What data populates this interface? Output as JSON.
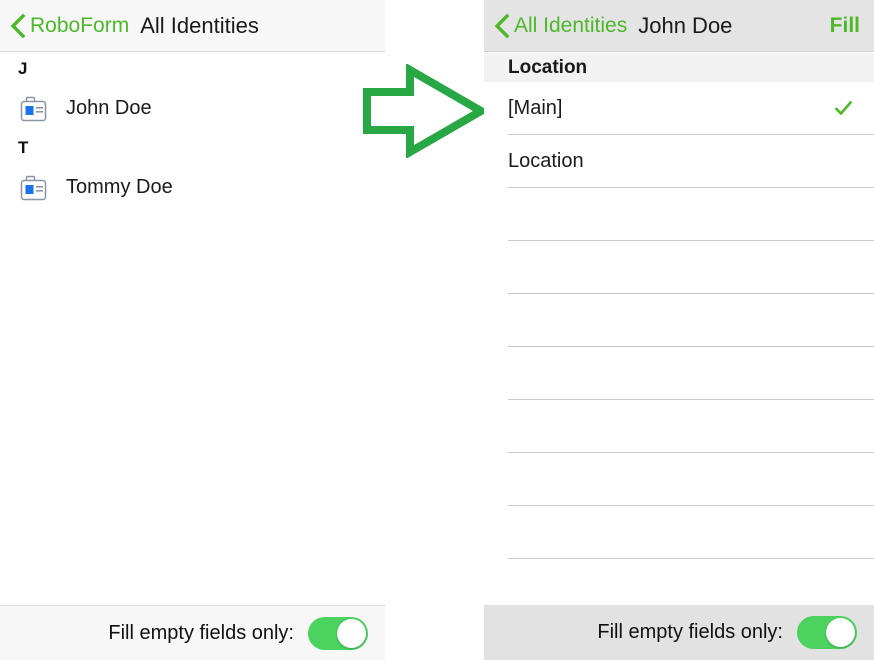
{
  "colors": {
    "accent_green": "#4cb82a",
    "toggle_green": "#4cd35f",
    "arrow_green": "#28a745",
    "icon_blue": "#1a73e8",
    "navbar_left_bg": "#f7f7f7",
    "navbar_right_bg": "#e4e4e4",
    "group_header_bg": "#f2f2f2",
    "bottombar_left_bg": "#f7f7f7",
    "bottombar_right_bg": "#e2e2e2",
    "text_primary": "#1a1a1a",
    "separator": "#c8c8c8"
  },
  "left_panel": {
    "navbar": {
      "back_icon": "chevron-left-icon",
      "back_label": "RoboForm",
      "title": "All Identities"
    },
    "sections": [
      {
        "letter": "J",
        "items": [
          {
            "icon": "id-card-icon",
            "label": "John Doe"
          }
        ]
      },
      {
        "letter": "T",
        "items": [
          {
            "icon": "id-card-icon",
            "label": "Tommy Doe"
          }
        ]
      }
    ],
    "bottombar": {
      "label": "Fill empty fields only:",
      "toggle_state": "on"
    }
  },
  "arrow": {
    "icon": "arrow-right-icon",
    "direction": "right"
  },
  "right_panel": {
    "navbar": {
      "back_icon": "chevron-left-icon",
      "back_label": "All Identities",
      "title": "John Doe",
      "action_label": "Fill"
    },
    "group_header": "Location",
    "rows": [
      {
        "label": "[Main]",
        "checked": true
      },
      {
        "label": "Location",
        "checked": false
      },
      {
        "label": "",
        "checked": false
      },
      {
        "label": "",
        "checked": false
      },
      {
        "label": "",
        "checked": false
      },
      {
        "label": "",
        "checked": false
      },
      {
        "label": "",
        "checked": false
      },
      {
        "label": "",
        "checked": false
      },
      {
        "label": "",
        "checked": false
      },
      {
        "label": "",
        "checked": false
      }
    ],
    "bottombar": {
      "label": "Fill empty fields only:",
      "toggle_state": "on"
    }
  }
}
